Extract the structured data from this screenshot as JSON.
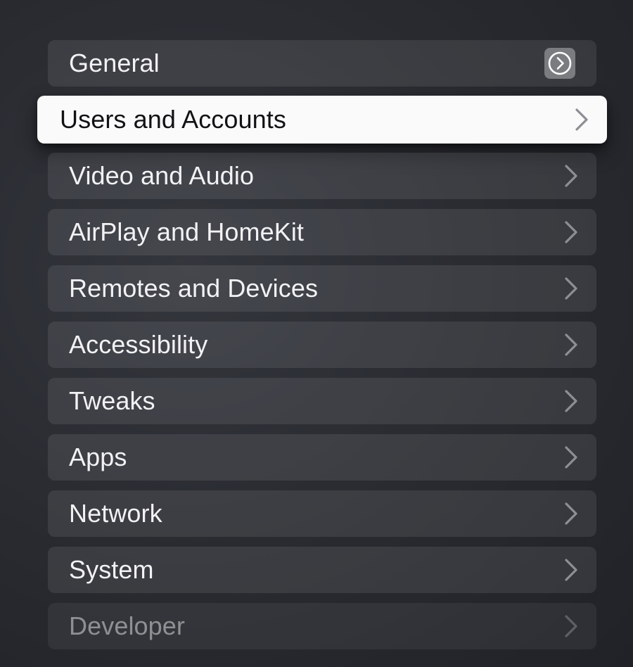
{
  "settings": {
    "items": [
      {
        "label": "General"
      },
      {
        "label": "Users and Accounts"
      },
      {
        "label": "Video and Audio"
      },
      {
        "label": "AirPlay and HomeKit"
      },
      {
        "label": "Remotes and Devices"
      },
      {
        "label": "Accessibility"
      },
      {
        "label": "Tweaks"
      },
      {
        "label": "Apps"
      },
      {
        "label": "Network"
      },
      {
        "label": "System"
      },
      {
        "label": "Developer"
      }
    ],
    "focused_item": "Users and Accounts"
  },
  "icons": {
    "row_chevron": "chevron-right-icon",
    "general_badge": "circle-chevron-right-icon"
  },
  "colors": {
    "background": "#2a2c32",
    "row_background": "#3a3c42",
    "focused_row_background": "#fafafa",
    "focused_text": "#111214",
    "text": "#f2f2f4",
    "chevron": "#8e8f94"
  }
}
